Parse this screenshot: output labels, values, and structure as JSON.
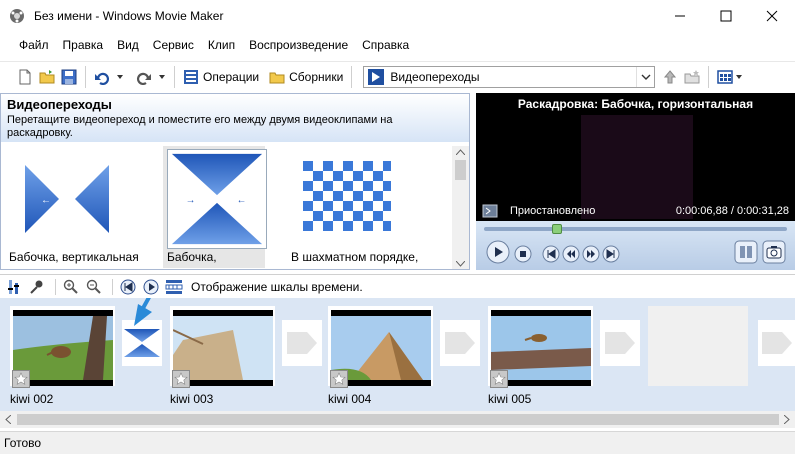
{
  "window": {
    "title": "Без имени - Windows Movie Maker"
  },
  "menu": [
    "Файл",
    "Правка",
    "Вид",
    "Сервис",
    "Клип",
    "Воспроизведение",
    "Справка"
  ],
  "toolbar": {
    "tasks_label": "Операции",
    "collections_label": "Сборники",
    "collection_select": "Видеопереходы"
  },
  "transitions": {
    "title": "Видеопереходы",
    "description": "Перетащите видеопереход и поместите его между двумя видеоклипами на раскадровку.",
    "items": [
      {
        "label": "Бабочка, вертикальная"
      },
      {
        "label": "Бабочка,"
      },
      {
        "label": "В шахматном порядке,"
      }
    ]
  },
  "player": {
    "title": "Раскадровка: Бабочка, горизонтальная",
    "status": "Приостановлено",
    "time": "0:00:06,88 / 0:00:31,28"
  },
  "timeline": {
    "toggle_label": "Отображение шкалы времени."
  },
  "clips": [
    {
      "label": "kiwi 002"
    },
    {
      "label": "kiwi 003"
    },
    {
      "label": "kiwi 004"
    },
    {
      "label": "kiwi 005"
    }
  ],
  "statusbar": {
    "text": "Готово"
  },
  "colors": {
    "accent": "#2f6fcf",
    "transition_blue": "#1f5fbf",
    "storyboard_bg": "#dbe6f4"
  }
}
